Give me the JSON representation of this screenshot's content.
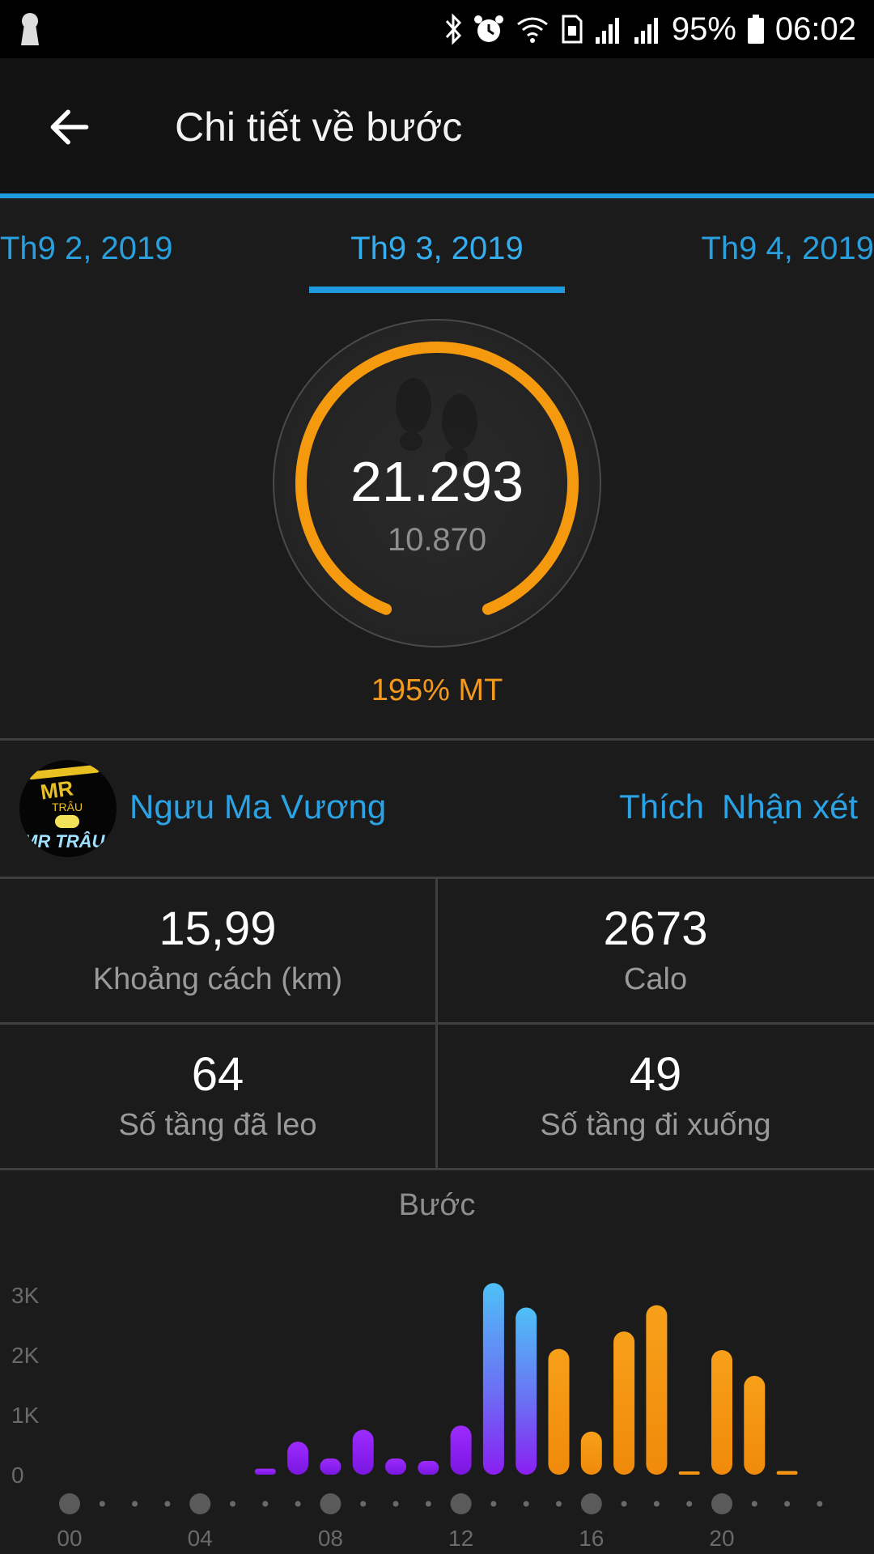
{
  "status_bar": {
    "battery": "95%",
    "time": "06:02",
    "icons": [
      "keyhole-icon",
      "bluetooth-icon",
      "alarm-icon",
      "wifi-icon",
      "sim-icon",
      "signal-icon",
      "signal-icon",
      "battery-icon"
    ]
  },
  "header": {
    "title": "Chi tiết về bước",
    "back_icon": "arrow-left-icon"
  },
  "date_tabs": {
    "prev": "Th9 2, 2019",
    "current": "Th9 3, 2019",
    "next": "Th9 4, 2019"
  },
  "summary": {
    "steps": "21.293",
    "goal": "10.870",
    "goal_percent_label": "195% MT",
    "progress_fraction": 1.0
  },
  "social": {
    "user_name": "Ngưu Ma Vương",
    "avatar_text_top": "MR",
    "avatar_text_mid": "TRÂU",
    "avatar_text_bottom": "MR TRÂU",
    "like_label": "Thích",
    "comment_label": "Nhận xét"
  },
  "stats": {
    "distance_value": "15,99",
    "distance_label": "Khoảng cách (km)",
    "calories_value": "2673",
    "calories_label": "Calo",
    "floors_up_value": "64",
    "floors_up_label": "Số tầng đã leo",
    "floors_down_value": "49",
    "floors_down_label": "Số tầng đi xuống"
  },
  "colors": {
    "accent_blue": "#1e9be0",
    "ring_orange": "#f59a0e",
    "bar_purple": "#8a1ff2",
    "bar_blue": "#4fb8f5",
    "bar_orange": "#f5900f"
  },
  "chart_data": {
    "type": "bar",
    "title": "Bước",
    "y_ticks": [
      "3K",
      "2K",
      "1K",
      "0"
    ],
    "ylim": [
      0,
      3000
    ],
    "x_tick_labels": [
      "00",
      "04",
      "08",
      "12",
      "16",
      "20"
    ],
    "hours": [
      0,
      1,
      2,
      3,
      4,
      5,
      6,
      7,
      8,
      9,
      10,
      11,
      12,
      13,
      14,
      15,
      16,
      17,
      18,
      19,
      20,
      21,
      22,
      23
    ],
    "values": [
      0,
      0,
      0,
      0,
      0,
      0,
      100,
      550,
      270,
      750,
      270,
      230,
      820,
      3200,
      2790,
      2100,
      720,
      2390,
      2830,
      30,
      2080,
      1650,
      60,
      0
    ],
    "bar_styles": [
      "none",
      "none",
      "none",
      "none",
      "none",
      "none",
      "purple",
      "purple",
      "purple",
      "purple",
      "purple",
      "purple",
      "purple",
      "blue-gradient",
      "blue-gradient",
      "orange",
      "orange",
      "orange",
      "orange",
      "orange",
      "orange",
      "orange",
      "orange",
      "none"
    ]
  }
}
